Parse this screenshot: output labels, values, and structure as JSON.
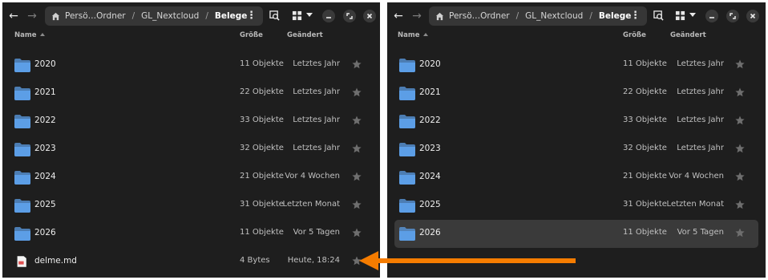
{
  "accent_folder": "#5c9ee6",
  "arrow_color": "#f57c00",
  "left_window": {
    "path": {
      "seg1": "Persö…Ordner",
      "seg2": "GL_Nextcloud",
      "current": "Belege",
      "separator": "/",
      "menu_glyph": "⋮"
    },
    "columns": {
      "name": "Name",
      "size": "Größe",
      "modified": "Geändert"
    },
    "items": [
      {
        "name": "2020",
        "size": "11 Objekte",
        "date": "Letztes Jahr",
        "type": "folder"
      },
      {
        "name": "2021",
        "size": "22 Objekte",
        "date": "Letztes Jahr",
        "type": "folder"
      },
      {
        "name": "2022",
        "size": "33 Objekte",
        "date": "Letztes Jahr",
        "type": "folder"
      },
      {
        "name": "2023",
        "size": "32 Objekte",
        "date": "Letztes Jahr",
        "type": "folder"
      },
      {
        "name": "2024",
        "size": "21 Objekte",
        "date": "Vor 4 Wochen",
        "type": "folder"
      },
      {
        "name": "2025",
        "size": "31 Objekte",
        "date": "Letzten Monat",
        "type": "folder"
      },
      {
        "name": "2026",
        "size": "11 Objekte",
        "date": "Vor 5 Tagen",
        "type": "folder"
      },
      {
        "name": "delme.md",
        "size": "4 Bytes",
        "date": "Heute, 18:24",
        "type": "markdown-file"
      }
    ]
  },
  "right_window": {
    "path": {
      "seg1": "Persö…Ordner",
      "seg2": "GL_Nextcloud",
      "current": "Belege",
      "separator": "/",
      "menu_glyph": "⋮"
    },
    "columns": {
      "name": "Name",
      "size": "Größe",
      "modified": "Geändert"
    },
    "selected_item": "2026",
    "items": [
      {
        "name": "2020",
        "size": "11 Objekte",
        "date": "Letztes Jahr",
        "type": "folder"
      },
      {
        "name": "2021",
        "size": "22 Objekte",
        "date": "Letztes Jahr",
        "type": "folder"
      },
      {
        "name": "2022",
        "size": "33 Objekte",
        "date": "Letztes Jahr",
        "type": "folder"
      },
      {
        "name": "2023",
        "size": "32 Objekte",
        "date": "Letztes Jahr",
        "type": "folder"
      },
      {
        "name": "2024",
        "size": "21 Objekte",
        "date": "Vor 4 Wochen",
        "type": "folder"
      },
      {
        "name": "2025",
        "size": "31 Objekte",
        "date": "Letzten Monat",
        "type": "folder"
      },
      {
        "name": "2026",
        "size": "11 Objekte",
        "date": "Vor 5 Tagen",
        "type": "folder"
      }
    ]
  }
}
